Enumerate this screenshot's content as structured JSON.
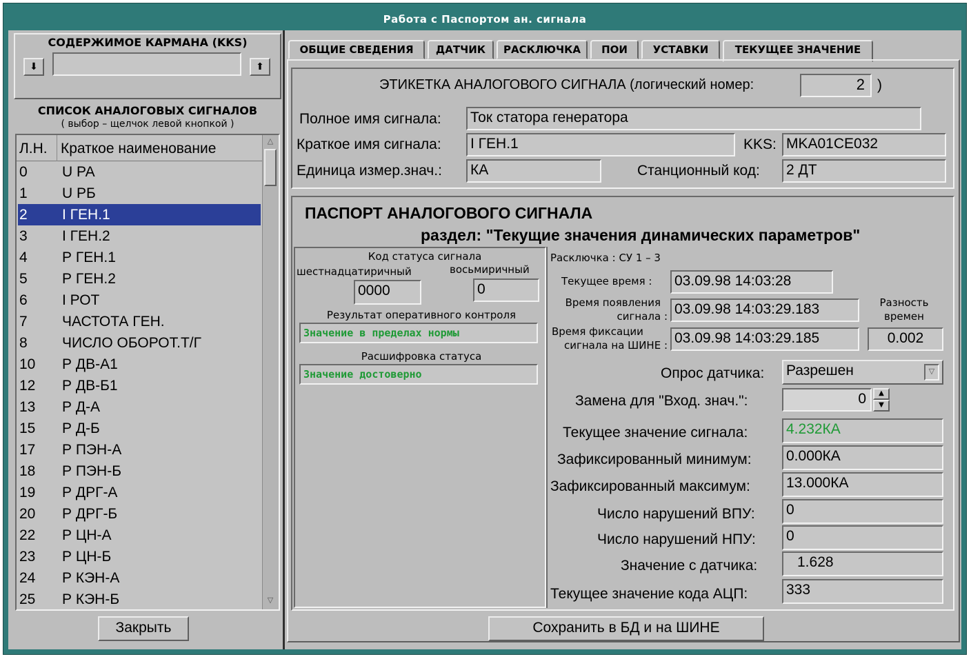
{
  "window": {
    "title": "Работа с Паспортом ан. сигнала"
  },
  "left": {
    "pocket_title": "СОДЕРЖИМОЕ КАРМАНА (KKS)",
    "pocket_value": "",
    "list_title": "СПИСОК АНАЛОГОВЫХ СИГНАЛОВ",
    "list_subtitle": "( выбор – щелчок левой кнопкой )",
    "col_num": "Л.Н.",
    "col_name": "Краткое наименование",
    "selected_index": 2,
    "rows": [
      {
        "num": "0",
        "name": "U РА"
      },
      {
        "num": "1",
        "name": "U РБ"
      },
      {
        "num": "2",
        "name": "I ГЕН.1"
      },
      {
        "num": "3",
        "name": "I ГЕН.2"
      },
      {
        "num": "4",
        "name": "Р ГЕН.1"
      },
      {
        "num": "5",
        "name": "Р ГЕН.2"
      },
      {
        "num": "6",
        "name": "I РОТ"
      },
      {
        "num": "7",
        "name": "ЧАСТОТА ГЕН."
      },
      {
        "num": "8",
        "name": "ЧИСЛО ОБОРОТ.Т/Г"
      },
      {
        "num": "10",
        "name": "Р ДВ-А1"
      },
      {
        "num": "12",
        "name": "Р ДВ-Б1"
      },
      {
        "num": "13",
        "name": "Р Д-А"
      },
      {
        "num": "15",
        "name": "Р Д-Б"
      },
      {
        "num": "17",
        "name": "Р ПЭН-А"
      },
      {
        "num": "18",
        "name": "Р ПЭН-Б"
      },
      {
        "num": "19",
        "name": "Р ДРГ-А"
      },
      {
        "num": "20",
        "name": "Р ДРГ-Б"
      },
      {
        "num": "22",
        "name": "Р ЦН-А"
      },
      {
        "num": "23",
        "name": "Р ЦН-Б"
      },
      {
        "num": "24",
        "name": "Р КЭН-А"
      },
      {
        "num": "25",
        "name": "Р КЭН-Б"
      }
    ],
    "close_label": "Закрыть"
  },
  "tabs": [
    "ОБЩИЕ СВЕДЕНИЯ",
    "ДАТЧИК",
    "РАСКЛЮЧКА",
    "ПОИ",
    "УСТАВКИ",
    "ТЕКУЩЕЕ ЗНАЧЕНИЕ"
  ],
  "label": {
    "header": "ЭТИКЕТКА АНАЛОГОВОГО СИГНАЛА (логический номер:",
    "close_paren": ")",
    "logical_number": "2",
    "full_name_label": "Полное имя сигнала:",
    "full_name": "Ток статора генератора",
    "short_name_label": "Краткое имя сигнала:",
    "short_name": "I ГЕН.1",
    "kks_label": "KKS:",
    "kks": "MKA01CE032",
    "unit_label": "Единица измер.знач.:",
    "unit": "КА",
    "station_label": "Станционный код:",
    "station_code": "2 ДТ"
  },
  "passport": {
    "title": "ПАСПОРТ АНАЛОГОВОГО СИГНАЛА",
    "section": "раздел: \"Текущие значения динамических параметров\"",
    "status_code_title": "Код статуса сигнала",
    "hex_label": "шестнадцатиричный",
    "oct_label": "восьмиричный",
    "hex_value": "0000",
    "oct_value": "0",
    "control_title": "Результат оперативного контроля",
    "control_value": "Значение в пределах нормы",
    "decode_title": "Расшифровка статуса",
    "decode_value": "Значение достоверно",
    "wiring": "Расключка :  СУ  1    – 3",
    "current_time_label": "Текущее время :",
    "current_time": "03.09.98   14:03:28",
    "appear_time_label_1": "Время появления",
    "appear_time_label_2": "сигнала :",
    "appear_time": "03.09.98   14:03:29.183",
    "bus_time_label_1": "Время фиксации",
    "bus_time_label_2": "сигнала на ШИНЕ :",
    "bus_time": "03.09.98   14:03:29.185",
    "diff_label_1": "Разность",
    "diff_label_2": "времен",
    "diff_value": "0.002",
    "poll_label": "Опрос датчика:",
    "poll_value": "Разрешен",
    "replace_label": "Замена для \"Вход. знач.\":",
    "replace_value": "0",
    "cur_value_label": "Текущее значение сигнала:",
    "cur_value": "4.232КА",
    "min_label": "Зафиксированный минимум:",
    "min_value": "0.000КА",
    "max_label": "Зафиксированный максимум:",
    "max_value": "13.000КА",
    "vpu_label": "Число нарушений ВПУ:",
    "vpu_value": "0",
    "npu_label": "Число нарушений НПУ:",
    "npu_value": "0",
    "sensor_label": "Значение с датчика:",
    "sensor_value": "1.628",
    "adc_label": "Текущее значение кода АЦП:",
    "adc_value": "333"
  },
  "save_label": "Сохранить в БД и на ШИНЕ",
  "colors": {
    "frame": "#2f7a78",
    "panel": "#bdbdbd",
    "selection": "#2b3f98",
    "ok_green": "#1f9a36"
  }
}
